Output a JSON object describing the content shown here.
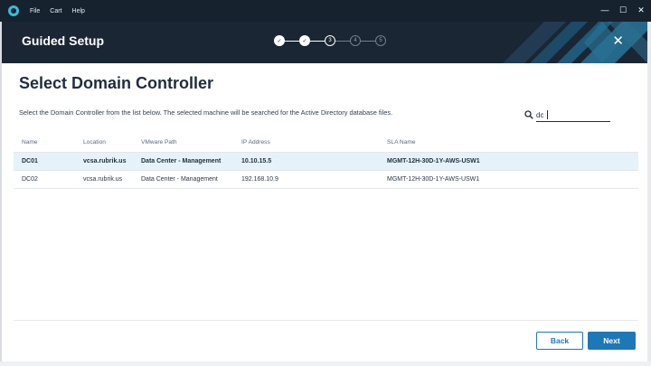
{
  "menu": {
    "items": [
      {
        "label": "File"
      },
      {
        "label": "Cart"
      },
      {
        "label": "Help"
      }
    ]
  },
  "window_controls": {
    "minimize": "—",
    "maximize": "☐",
    "close": "✕"
  },
  "header": {
    "title": "Guided Setup",
    "close_glyph": "✕",
    "steps": [
      {
        "label": "✓",
        "state": "done"
      },
      {
        "label": "✓",
        "state": "done"
      },
      {
        "label": "3",
        "state": "current"
      },
      {
        "label": "4",
        "state": "todo"
      },
      {
        "label": "5",
        "state": "todo"
      }
    ],
    "brand_color": "#1a2633",
    "accent_color": "#3bb9d8"
  },
  "page": {
    "title": "Select Domain Controller",
    "description": "Select the Domain Controller from the list below. The selected machine will be searched for the Active Directory database files."
  },
  "search": {
    "value": "dc",
    "icon": "search-icon"
  },
  "table": {
    "columns": [
      "Name",
      "Location",
      "VMware Path",
      "IP Address",
      "SLA Name"
    ],
    "rows": [
      {
        "name": "DC01",
        "location": "vcsa.rubrik.us",
        "vmware_path": "Data Center - Management",
        "ip": "10.10.15.5",
        "sla": "MGMT-12H-30D-1Y-AWS-USW1",
        "selected": true
      },
      {
        "name": "DC02",
        "location": "vcsa.rubrik.us",
        "vmware_path": "Data Center - Management",
        "ip": "192.168.10.9",
        "sla": "MGMT-12H-30D-1Y-AWS-USW1",
        "selected": false
      }
    ]
  },
  "footer": {
    "back_label": "Back",
    "next_label": "Next",
    "primary_color": "#1d78b8"
  }
}
